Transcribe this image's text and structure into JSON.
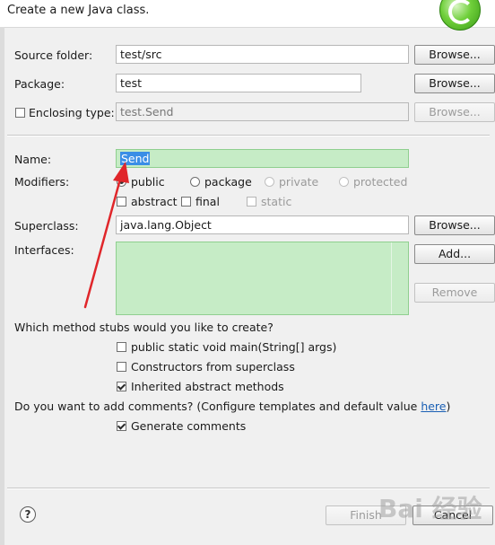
{
  "header": {
    "text": "Create a new Java class."
  },
  "source_folder": {
    "label": "Source folder:",
    "value": "test/src",
    "browse": "Browse..."
  },
  "package": {
    "label": "Package:",
    "value": "test",
    "browse": "Browse..."
  },
  "enclosing": {
    "label": "Enclosing type:",
    "value": "test.Send",
    "browse": "Browse...",
    "checked": false
  },
  "name": {
    "label": "Name:",
    "value": "Send"
  },
  "modifiers": {
    "label": "Modifiers:",
    "public": "public",
    "package": "package",
    "private": "private",
    "protected": "protected",
    "abstract": "abstract",
    "final": "final",
    "static": "static",
    "selected": "public"
  },
  "superclass": {
    "label": "Superclass:",
    "value": "java.lang.Object",
    "browse": "Browse..."
  },
  "interfaces": {
    "label": "Interfaces:",
    "add": "Add...",
    "remove": "Remove"
  },
  "stubs": {
    "question": "Which method stubs would you like to create?",
    "main": "public static void main(String[] args)",
    "constructors": "Constructors from superclass",
    "inherited": "Inherited abstract methods",
    "main_checked": false,
    "constructors_checked": false,
    "inherited_checked": true
  },
  "comments": {
    "question_prefix": "Do you want to add comments? (Configure templates and default value ",
    "link": "here",
    "question_suffix": ")",
    "generate": "Generate comments",
    "generate_checked": true
  },
  "footer": {
    "help": "?",
    "finish": "Finish",
    "cancel": "Cancel"
  },
  "watermark": "Bai 经验",
  "colors": {
    "field_green": "#c6ecc6",
    "selection_blue": "#3a8ee6",
    "arrow_red": "#e0262a"
  }
}
